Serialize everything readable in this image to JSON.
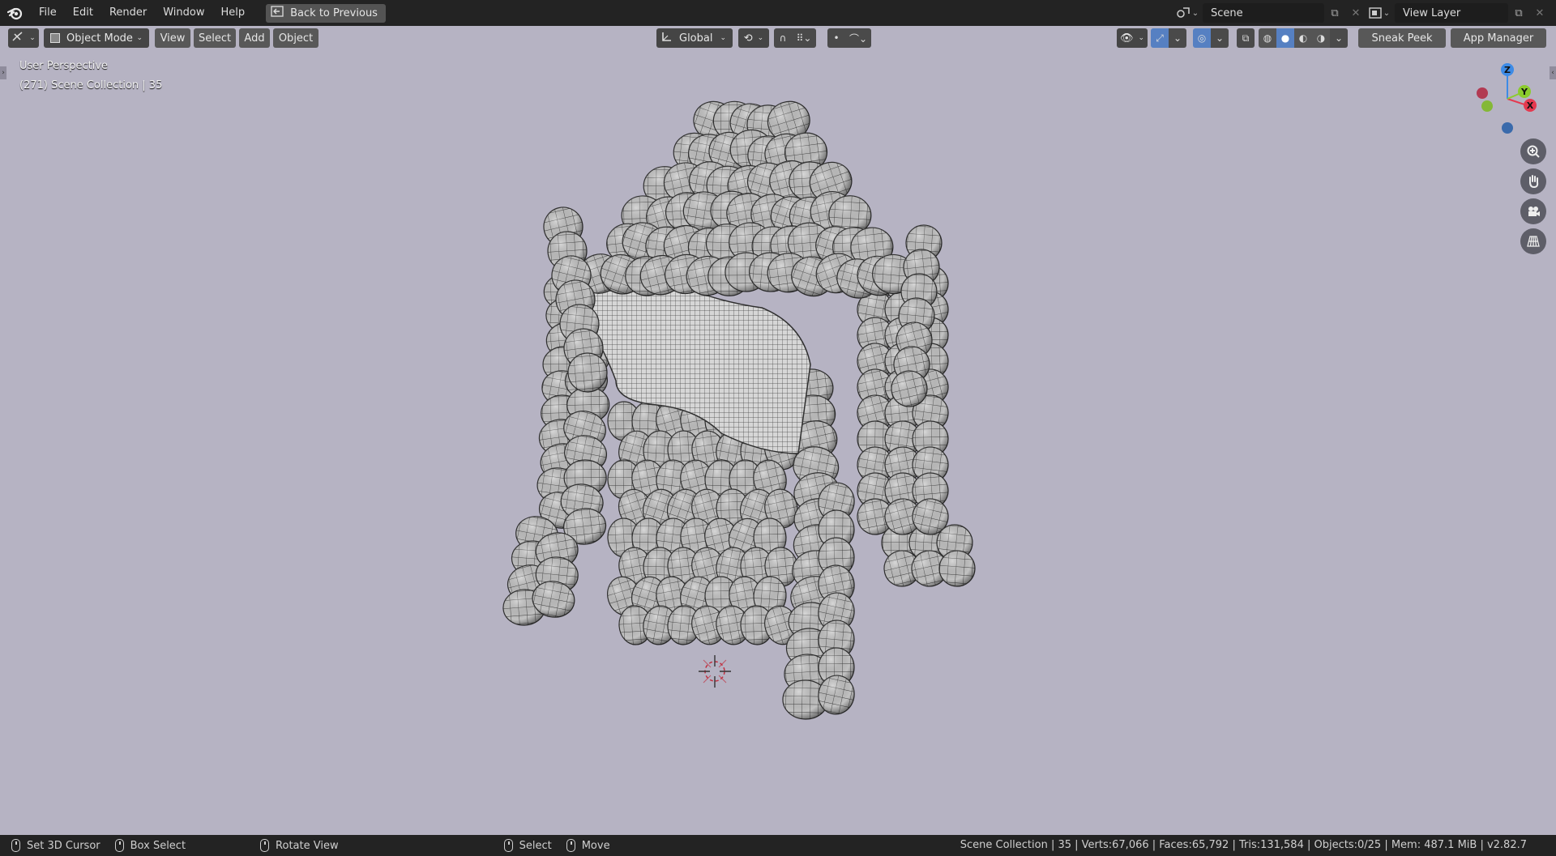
{
  "menubar": {
    "items": [
      "File",
      "Edit",
      "Render",
      "Window",
      "Help"
    ],
    "back_button": "Back to Previous",
    "scene_name": "Scene",
    "view_layer": "View Layer"
  },
  "toolbar": {
    "mode": "Object Mode",
    "menus": [
      "View",
      "Select",
      "Add",
      "Object"
    ],
    "transform_orientation": "Global",
    "sneak_peek": "Sneak Peek",
    "app_manager": "App Manager"
  },
  "viewport": {
    "view_name": "User Perspective",
    "collection_info": "(271) Scene Collection | 35",
    "background_color": "#b6b3c3"
  },
  "gizmo": {
    "z_label": "Z",
    "y_label": "Y",
    "x_label": "X",
    "colors": {
      "x": "#e5394f",
      "y": "#8ccc2e",
      "z": "#3d8be6"
    }
  },
  "statusbar": {
    "items": [
      {
        "label": "Set 3D Cursor"
      },
      {
        "label": "Box Select"
      },
      {
        "label": "Rotate View"
      },
      {
        "label": "Select"
      },
      {
        "label": "Move"
      }
    ],
    "stats": "Scene Collection | 35 | Verts:67,066 | Faces:65,792 | Tris:131,584 | Objects:0/25 | Mem: 487.1 MiB | v2.82.7"
  }
}
